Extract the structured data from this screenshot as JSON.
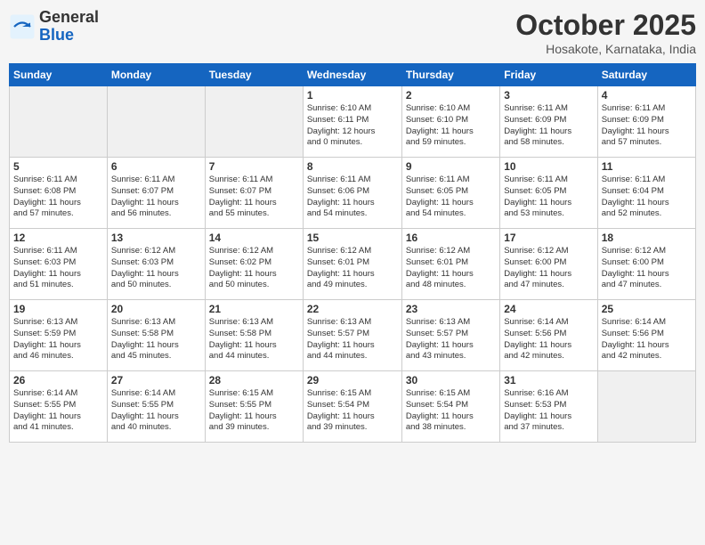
{
  "logo": {
    "general": "General",
    "blue": "Blue"
  },
  "header": {
    "month": "October 2025",
    "location": "Hosakote, Karnataka, India"
  },
  "weekdays": [
    "Sunday",
    "Monday",
    "Tuesday",
    "Wednesday",
    "Thursday",
    "Friday",
    "Saturday"
  ],
  "weeks": [
    [
      {
        "day": "",
        "info": ""
      },
      {
        "day": "",
        "info": ""
      },
      {
        "day": "",
        "info": ""
      },
      {
        "day": "1",
        "info": "Sunrise: 6:10 AM\nSunset: 6:11 PM\nDaylight: 12 hours\nand 0 minutes."
      },
      {
        "day": "2",
        "info": "Sunrise: 6:10 AM\nSunset: 6:10 PM\nDaylight: 11 hours\nand 59 minutes."
      },
      {
        "day": "3",
        "info": "Sunrise: 6:11 AM\nSunset: 6:09 PM\nDaylight: 11 hours\nand 58 minutes."
      },
      {
        "day": "4",
        "info": "Sunrise: 6:11 AM\nSunset: 6:09 PM\nDaylight: 11 hours\nand 57 minutes."
      }
    ],
    [
      {
        "day": "5",
        "info": "Sunrise: 6:11 AM\nSunset: 6:08 PM\nDaylight: 11 hours\nand 57 minutes."
      },
      {
        "day": "6",
        "info": "Sunrise: 6:11 AM\nSunset: 6:07 PM\nDaylight: 11 hours\nand 56 minutes."
      },
      {
        "day": "7",
        "info": "Sunrise: 6:11 AM\nSunset: 6:07 PM\nDaylight: 11 hours\nand 55 minutes."
      },
      {
        "day": "8",
        "info": "Sunrise: 6:11 AM\nSunset: 6:06 PM\nDaylight: 11 hours\nand 54 minutes."
      },
      {
        "day": "9",
        "info": "Sunrise: 6:11 AM\nSunset: 6:05 PM\nDaylight: 11 hours\nand 54 minutes."
      },
      {
        "day": "10",
        "info": "Sunrise: 6:11 AM\nSunset: 6:05 PM\nDaylight: 11 hours\nand 53 minutes."
      },
      {
        "day": "11",
        "info": "Sunrise: 6:11 AM\nSunset: 6:04 PM\nDaylight: 11 hours\nand 52 minutes."
      }
    ],
    [
      {
        "day": "12",
        "info": "Sunrise: 6:11 AM\nSunset: 6:03 PM\nDaylight: 11 hours\nand 51 minutes."
      },
      {
        "day": "13",
        "info": "Sunrise: 6:12 AM\nSunset: 6:03 PM\nDaylight: 11 hours\nand 50 minutes."
      },
      {
        "day": "14",
        "info": "Sunrise: 6:12 AM\nSunset: 6:02 PM\nDaylight: 11 hours\nand 50 minutes."
      },
      {
        "day": "15",
        "info": "Sunrise: 6:12 AM\nSunset: 6:01 PM\nDaylight: 11 hours\nand 49 minutes."
      },
      {
        "day": "16",
        "info": "Sunrise: 6:12 AM\nSunset: 6:01 PM\nDaylight: 11 hours\nand 48 minutes."
      },
      {
        "day": "17",
        "info": "Sunrise: 6:12 AM\nSunset: 6:00 PM\nDaylight: 11 hours\nand 47 minutes."
      },
      {
        "day": "18",
        "info": "Sunrise: 6:12 AM\nSunset: 6:00 PM\nDaylight: 11 hours\nand 47 minutes."
      }
    ],
    [
      {
        "day": "19",
        "info": "Sunrise: 6:13 AM\nSunset: 5:59 PM\nDaylight: 11 hours\nand 46 minutes."
      },
      {
        "day": "20",
        "info": "Sunrise: 6:13 AM\nSunset: 5:58 PM\nDaylight: 11 hours\nand 45 minutes."
      },
      {
        "day": "21",
        "info": "Sunrise: 6:13 AM\nSunset: 5:58 PM\nDaylight: 11 hours\nand 44 minutes."
      },
      {
        "day": "22",
        "info": "Sunrise: 6:13 AM\nSunset: 5:57 PM\nDaylight: 11 hours\nand 44 minutes."
      },
      {
        "day": "23",
        "info": "Sunrise: 6:13 AM\nSunset: 5:57 PM\nDaylight: 11 hours\nand 43 minutes."
      },
      {
        "day": "24",
        "info": "Sunrise: 6:14 AM\nSunset: 5:56 PM\nDaylight: 11 hours\nand 42 minutes."
      },
      {
        "day": "25",
        "info": "Sunrise: 6:14 AM\nSunset: 5:56 PM\nDaylight: 11 hours\nand 42 minutes."
      }
    ],
    [
      {
        "day": "26",
        "info": "Sunrise: 6:14 AM\nSunset: 5:55 PM\nDaylight: 11 hours\nand 41 minutes."
      },
      {
        "day": "27",
        "info": "Sunrise: 6:14 AM\nSunset: 5:55 PM\nDaylight: 11 hours\nand 40 minutes."
      },
      {
        "day": "28",
        "info": "Sunrise: 6:15 AM\nSunset: 5:55 PM\nDaylight: 11 hours\nand 39 minutes."
      },
      {
        "day": "29",
        "info": "Sunrise: 6:15 AM\nSunset: 5:54 PM\nDaylight: 11 hours\nand 39 minutes."
      },
      {
        "day": "30",
        "info": "Sunrise: 6:15 AM\nSunset: 5:54 PM\nDaylight: 11 hours\nand 38 minutes."
      },
      {
        "day": "31",
        "info": "Sunrise: 6:16 AM\nSunset: 5:53 PM\nDaylight: 11 hours\nand 37 minutes."
      },
      {
        "day": "",
        "info": ""
      }
    ]
  ]
}
